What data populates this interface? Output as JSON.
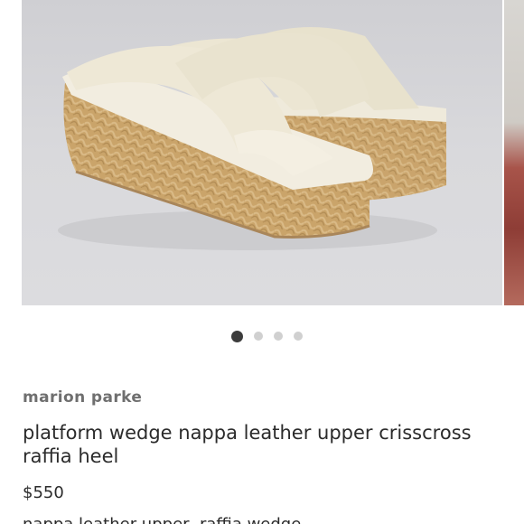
{
  "carousel": {
    "image_alt": "platform wedge sandal photo",
    "slide_count": 4,
    "active_index": 0
  },
  "product": {
    "brand": "marion parke",
    "title": "platform wedge nappa leather upper crisscross raffia heel",
    "price": "$550",
    "description_partial": "nappa leather upper, raffia wedge"
  },
  "colors": {
    "background": "#ffffff",
    "dot_active": "#3c3c3c",
    "dot_inactive": "#d0d0d0",
    "brand_text": "#6f6f6f",
    "body_text": "#2b2b2b"
  }
}
